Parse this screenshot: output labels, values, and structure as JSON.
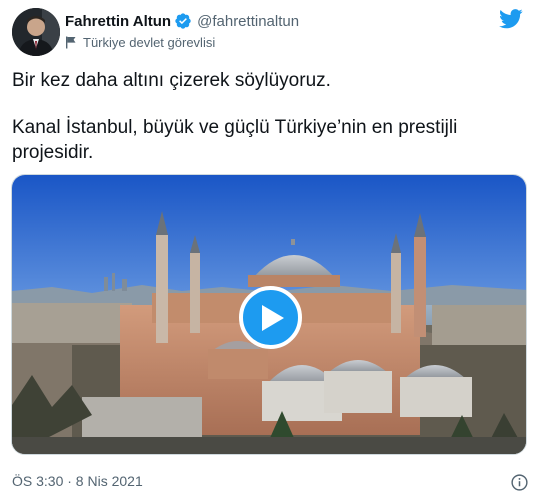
{
  "tweet": {
    "author_name": "Fahrettin Altun",
    "author_handle": "@fahrettinaltun",
    "account_label": "Türkiye devlet görevlisi",
    "text_line_1": "Bir kez daha altını çizerek söylüyoruz.",
    "text_line_2": "Kanal İstanbul, büyük ve güçlü Türkiye’nin en prestijli projesidir.",
    "timestamp": "ÖS 3:30 · 8 Nis 2021"
  },
  "icons": {
    "verified": "verified-badge-icon",
    "account_label": "flag-icon",
    "brand": "twitter-bird-icon",
    "play": "play-icon",
    "info": "info-icon"
  },
  "colors": {
    "accent": "#1d9bf0",
    "text": "#0f1419",
    "secondary": "#536471"
  }
}
